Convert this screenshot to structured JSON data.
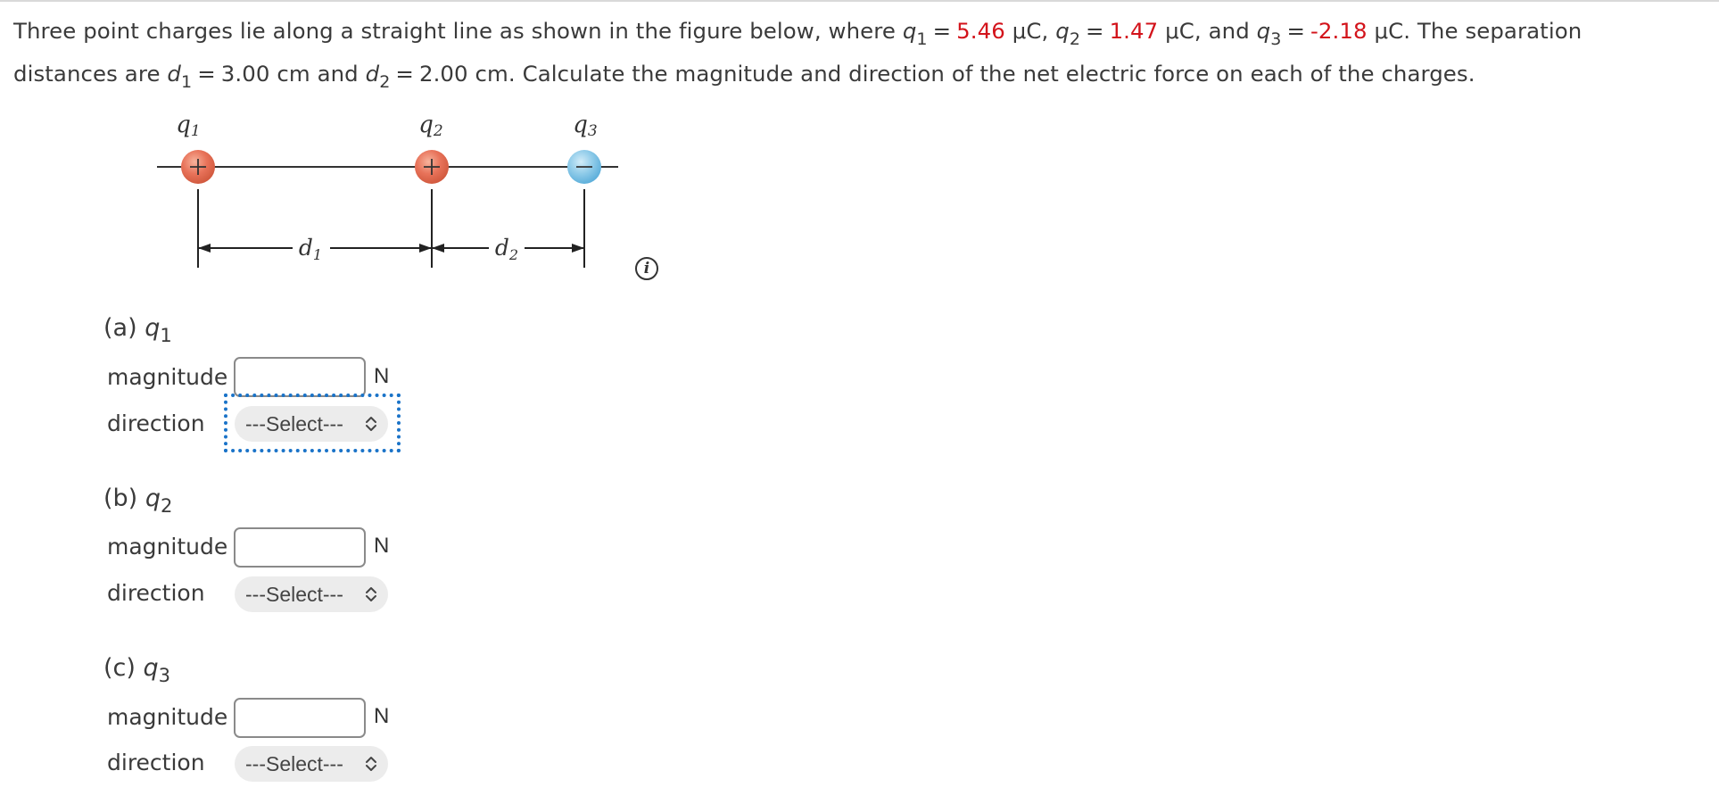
{
  "problem": {
    "intro": "Three point charges lie along a straight line as shown in the figure below, where",
    "q1_symbol": "q",
    "q1_sub": "1",
    "q1_value": "5.46",
    "q2_symbol": "q",
    "q2_sub": "2",
    "q2_value": "1.47",
    "q3_symbol": "q",
    "q3_sub": "3",
    "q3_value": "-2.18",
    "charge_unit": "μC",
    "and_text": "and",
    "separation_text": ". The separation",
    "line2_start": "distances are",
    "d1_symbol": "d",
    "d1_sub": "1",
    "d1_value": "3.00 cm",
    "d2_symbol": "d",
    "d2_sub": "2",
    "d2_value": "2.00 cm.",
    "line2_end": "Calculate the magnitude and direction of the net electric force on each of the charges.",
    "equals": "=",
    "comma": ",",
    "value_color": "#d3131b"
  },
  "figure": {
    "charges": [
      {
        "label": "q",
        "sub": "1",
        "sign": "+",
        "color": "#e8735a"
      },
      {
        "label": "q",
        "sub": "2",
        "sign": "+",
        "color": "#e8735a"
      },
      {
        "label": "q",
        "sub": "3",
        "sign": "−",
        "color": "#7cc4e6"
      }
    ],
    "distances": [
      {
        "label": "d",
        "sub": "1"
      },
      {
        "label": "d",
        "sub": "2"
      }
    ],
    "info_icon": "i"
  },
  "parts": [
    {
      "label": "(a)",
      "symbol": "q",
      "sub": "1",
      "magnitude_label": "magnitude",
      "magnitude_value": "",
      "unit": "N",
      "direction_label": "direction",
      "direction_value": "---Select---",
      "focused": true
    },
    {
      "label": "(b)",
      "symbol": "q",
      "sub": "2",
      "magnitude_label": "magnitude",
      "magnitude_value": "",
      "unit": "N",
      "direction_label": "direction",
      "direction_value": "---Select---",
      "focused": false
    },
    {
      "label": "(c)",
      "symbol": "q",
      "sub": "3",
      "magnitude_label": "magnitude",
      "magnitude_value": "",
      "unit": "N",
      "direction_label": "direction",
      "direction_value": "---Select---",
      "focused": false
    }
  ]
}
